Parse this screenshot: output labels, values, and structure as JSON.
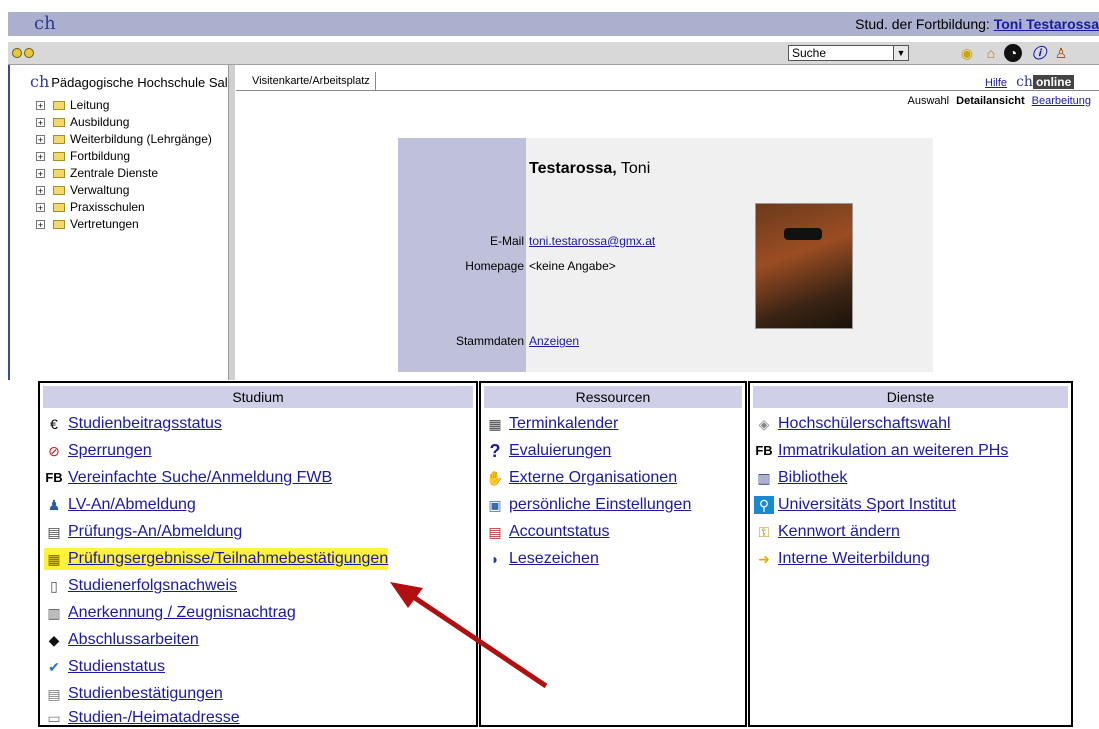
{
  "header": {
    "logo_text": "ch",
    "user_prefix": "Stud. der Fortbildung:",
    "user_name": "Toni Testarossa"
  },
  "toolbar": {
    "search_select": "Suche"
  },
  "tree": {
    "title": "Pädagogische Hochschule Salz",
    "items": [
      {
        "label": "Leitung"
      },
      {
        "label": "Ausbildung"
      },
      {
        "label": "Weiterbildung (Lehrgänge)"
      },
      {
        "label": "Fortbildung"
      },
      {
        "label": "Zentrale Dienste"
      },
      {
        "label": "Verwaltung"
      },
      {
        "label": "Praxisschulen"
      },
      {
        "label": "Vertretungen"
      }
    ]
  },
  "tabs": {
    "active": "Visitenkarte/Arbeitsplatz",
    "help": "Hilfe",
    "online_logo": "online"
  },
  "view_switch": {
    "auswahl": "Auswahl",
    "detail": "Detailansicht",
    "bearbeitung": "Bearbeitung"
  },
  "card": {
    "last_name": "Testarossa,",
    "first_name": "Toni",
    "email_label": "E-Mail",
    "email": "toni.testarossa@gmx.at",
    "homepage_label": "Homepage",
    "homepage": "<keine Angabe>",
    "stammdaten_label": "Stammdaten",
    "stammdaten_link": "Anzeigen"
  },
  "columns": [
    {
      "title": "Studium",
      "items": [
        {
          "label": "Studienbeitragsstatus",
          "icon": "euro-icon"
        },
        {
          "label": "Sperrungen",
          "icon": "block-icon"
        },
        {
          "label": "Vereinfachte Suche/Anmeldung FWB",
          "icon": "fb-icon"
        },
        {
          "label": "LV-An/Abmeldung",
          "icon": "people-icon"
        },
        {
          "label": "Prüfungs-An/Abmeldung",
          "icon": "computer-icon"
        },
        {
          "label": "Prüfungsergebnisse/Teilnahmebestätigungen",
          "icon": "results-icon"
        },
        {
          "label": "Studienerfolgsnachweis",
          "icon": "document-icon"
        },
        {
          "label": "Anerkennung / Zeugnisnachtrag",
          "icon": "certificate-icon"
        },
        {
          "label": "Abschlussarbeiten",
          "icon": "graduation-cap-icon"
        },
        {
          "label": "Studienstatus",
          "icon": "status-icon"
        },
        {
          "label": "Studienbestätigungen",
          "icon": "confirmation-icon"
        },
        {
          "label": "Studien-/Heimatadresse",
          "icon": "address-icon"
        }
      ]
    },
    {
      "title": "Ressourcen",
      "items": [
        {
          "label": "Terminkalender",
          "icon": "calendar-icon"
        },
        {
          "label": "Evaluierungen",
          "icon": "question-icon"
        },
        {
          "label": "Externe Organisationen",
          "icon": "handshake-icon"
        },
        {
          "label": "persönliche Einstellungen",
          "icon": "settings-icon"
        },
        {
          "label": "Accountstatus",
          "icon": "account-icon"
        },
        {
          "label": "Lesezeichen",
          "icon": "bookmark-icon"
        }
      ]
    },
    {
      "title": "Dienste",
      "items": [
        {
          "label": "Hochschülerschaftswahl",
          "icon": "ballot-icon"
        },
        {
          "label": "Immatrikulation an weiteren PHs",
          "icon": "fb-icon"
        },
        {
          "label": "Bibliothek",
          "icon": "library-icon"
        },
        {
          "label": "Universitäts Sport Institut",
          "icon": "sport-icon"
        },
        {
          "label": "Kennwort ändern",
          "icon": "key-icon"
        },
        {
          "label": "Interne Weiterbildung",
          "icon": "arrow-right-icon"
        }
      ]
    }
  ],
  "colors": {
    "title_bar": "#aab0cd",
    "column_header": "#cfcfe8",
    "highlight": "#fff23a",
    "annotation_arrow": "#b01010"
  }
}
